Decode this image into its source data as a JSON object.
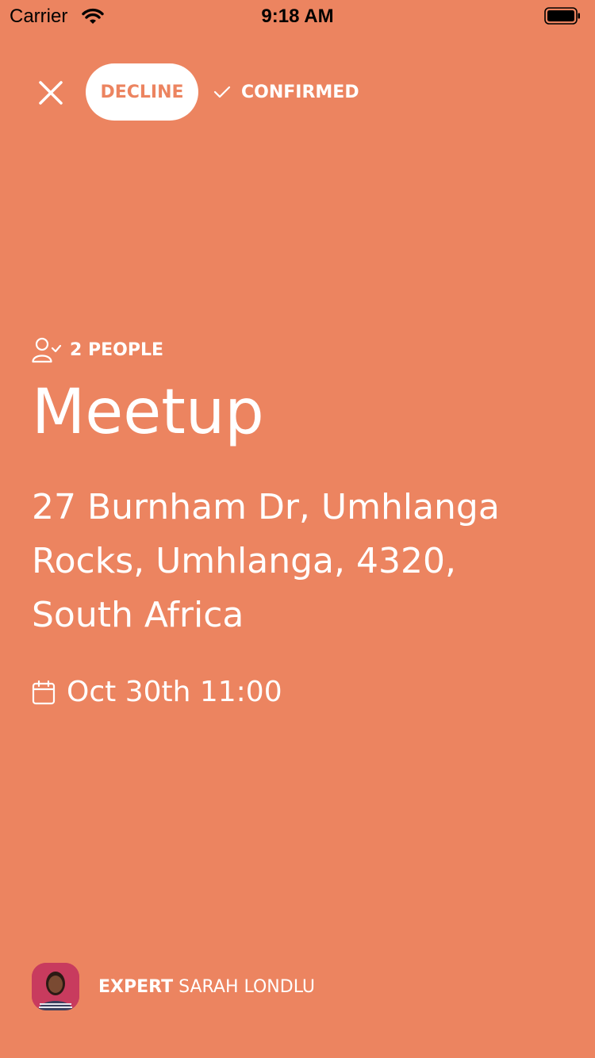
{
  "status_bar": {
    "carrier": "Carrier",
    "time": "9:18 AM",
    "wifi_icon": "wifi-icon",
    "battery_icon": "battery-icon"
  },
  "actions": {
    "close_icon": "close-icon",
    "decline_label": "DECLINE",
    "confirmed_label": "CONFIRMED",
    "check_icon": "check-icon"
  },
  "event": {
    "people_icon": "user-check-icon",
    "people_label": "2 PEOPLE",
    "title": "Meetup",
    "address": "27 Burnham Dr, Umhlanga Rocks, Umhlanga, 4320, South Africa",
    "calendar_icon": "calendar-icon",
    "datetime": "Oct 30th 11:00"
  },
  "expert": {
    "role": "EXPERT",
    "name": "SARAH LONDLU"
  },
  "colors": {
    "background": "#EC8460",
    "text": "#FFFFFF",
    "decline_bg": "#FFFFFF",
    "decline_text": "#EC8460"
  }
}
